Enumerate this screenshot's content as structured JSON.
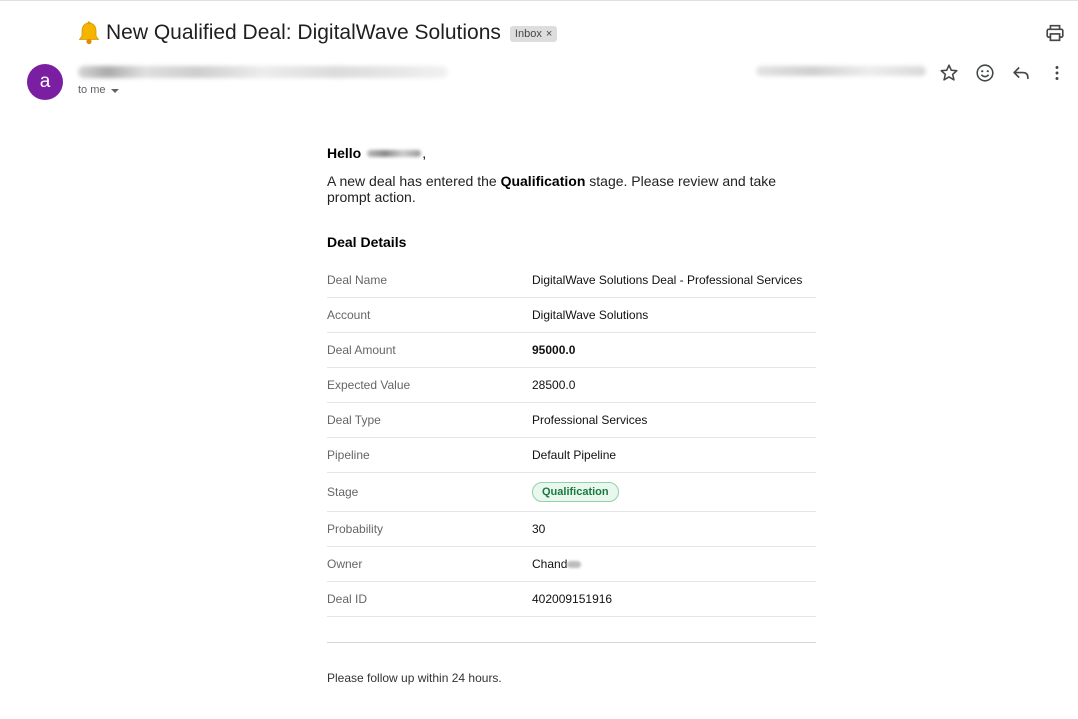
{
  "subject": "New Qualified Deal: DigitalWave Solutions",
  "inbox_label": "Inbox",
  "inbox_remove": "×",
  "avatar_letter": "a",
  "to_me": "to me",
  "icons": {
    "subject": "bell-icon",
    "print": "print-icon",
    "star": "star-icon",
    "emoji": "emoji-icon",
    "reply": "reply-icon",
    "more": "more-vert-icon",
    "caret": "caret-down-icon"
  },
  "colors": {
    "avatar": "#7b1fa2",
    "stage_badge_bg": "#e9f7ef",
    "stage_badge_text": "#1a7a3c"
  },
  "body": {
    "hello": "Hello",
    "intro_pre": "A new deal has entered the ",
    "intro_stage": "Qualification",
    "intro_post": " stage. Please review and take prompt action.",
    "section_title": "Deal Details",
    "rows": [
      {
        "label": "Deal Name",
        "value": "DigitalWave Solutions Deal - Professional Services"
      },
      {
        "label": "Account",
        "value": "DigitalWave Solutions"
      },
      {
        "label": "Deal Amount",
        "value": "95000.0"
      },
      {
        "label": "Expected Value",
        "value": "28500.0"
      },
      {
        "label": "Deal Type",
        "value": "Professional Services"
      },
      {
        "label": "Pipeline",
        "value": "Default Pipeline"
      },
      {
        "label": "Stage",
        "value": "Qualification"
      },
      {
        "label": "Probability",
        "value": "30"
      },
      {
        "label": "Owner",
        "value": "Chand"
      },
      {
        "label": "Deal ID",
        "value": "402009151916"
      }
    ],
    "footer": "Please follow up within 24 hours."
  }
}
